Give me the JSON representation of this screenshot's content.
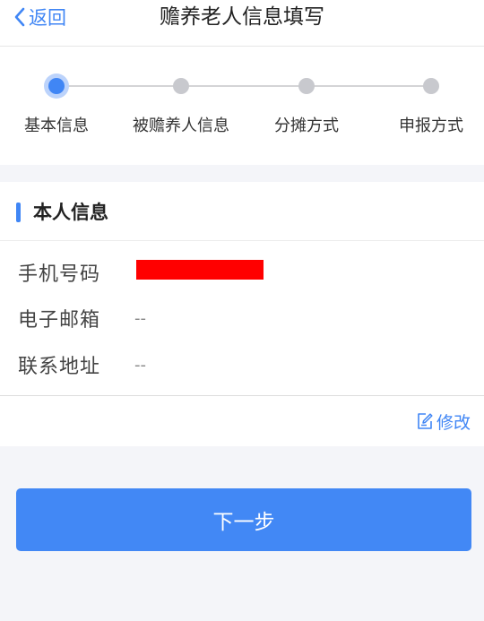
{
  "nav": {
    "back_label": "返回",
    "title": "赡养老人信息填写"
  },
  "stepper": {
    "steps": [
      {
        "label": "基本信息",
        "active": true
      },
      {
        "label": "被赡养人信息",
        "active": false
      },
      {
        "label": "分摊方式",
        "active": false
      },
      {
        "label": "申报方式",
        "active": false
      }
    ]
  },
  "section": {
    "title": "本人信息"
  },
  "fields": [
    {
      "label": "手机号码",
      "value": ""
    },
    {
      "label": "电子邮箱",
      "value": "--"
    },
    {
      "label": "联系地址",
      "value": "--"
    }
  ],
  "edit_label": "修改",
  "next_button_label": "下一步",
  "colors": {
    "accent": "#4086f5",
    "redaction": "#ff0000",
    "inactive_dot": "#c8c9ce"
  },
  "icons": {
    "back": "chevron-left-icon",
    "edit": "edit-icon"
  }
}
